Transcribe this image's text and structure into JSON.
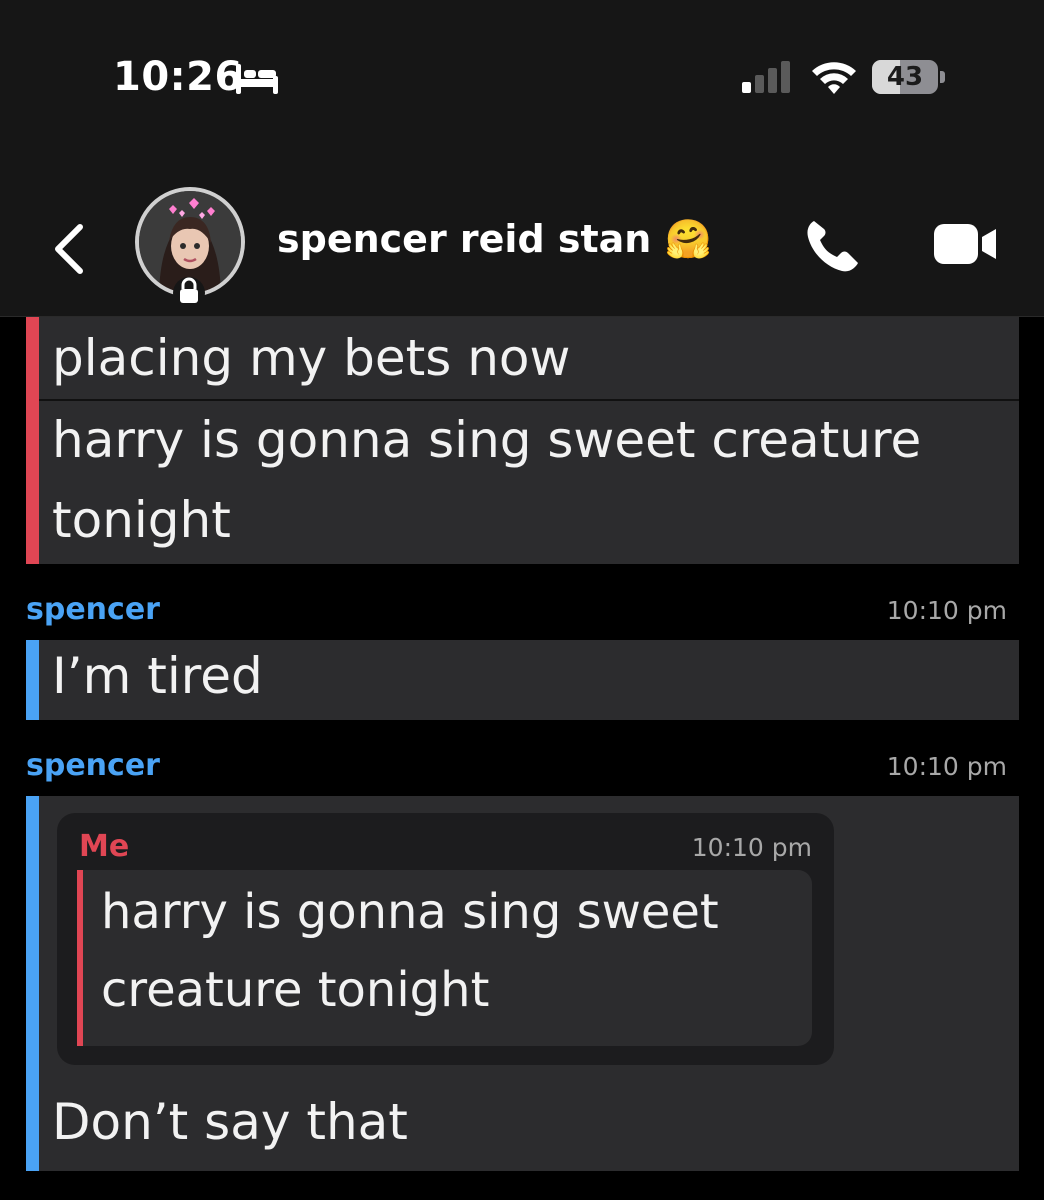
{
  "status_bar": {
    "time": "10:26",
    "battery_level": "43",
    "battery_fraction": 0.43,
    "icons": [
      "sleep-focus-icon",
      "cellular-signal-icon",
      "wifi-icon",
      "battery-icon"
    ]
  },
  "header": {
    "contact_name": "spencer reid stan 🤗",
    "icons": [
      "chevron-left-icon",
      "avatar",
      "lock-icon",
      "phone-icon",
      "video-camera-icon"
    ]
  },
  "messages": {
    "block1": {
      "lines": [
        "placing my bets now",
        "harry is gonna sing sweet creature",
        "tonight"
      ],
      "bar_color": "#e04654"
    },
    "msg2": {
      "sender": "spencer",
      "time": "10:10 pm",
      "text": "I’m tired",
      "bar_color": "#4aa3f5"
    },
    "msg3": {
      "sender": "spencer",
      "time": "10:10 pm",
      "quote": {
        "sender": "Me",
        "time": "10:10 pm",
        "lines": [
          "harry is gonna sing sweet",
          "creature tonight"
        ]
      },
      "text": "Don’t say that",
      "bar_color": "#4aa3f5"
    }
  },
  "colors": {
    "me_accent": "#e04654",
    "friend_accent": "#4aa3f5",
    "bubble_bg": "#2c2c2e",
    "header_bg": "#161616"
  }
}
